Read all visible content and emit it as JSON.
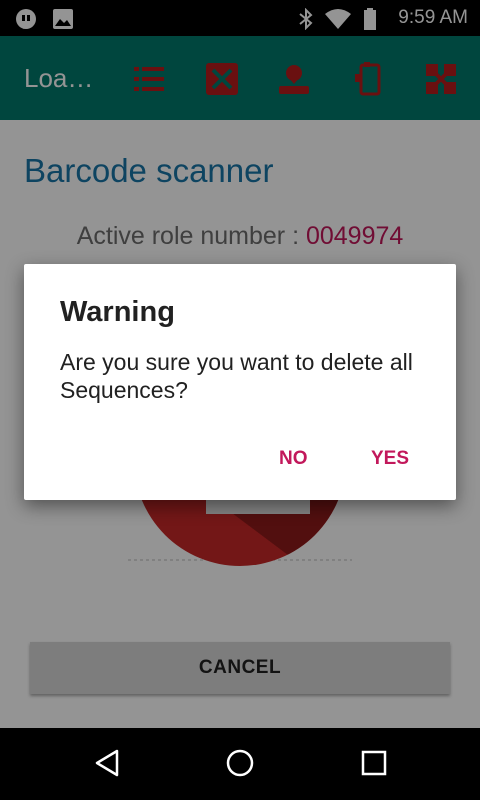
{
  "status_bar": {
    "time": "9:59 AM",
    "icons": [
      "chat-notification-icon",
      "image-icon",
      "bluetooth-icon",
      "wifi-icon",
      "battery-icon"
    ]
  },
  "app_bar": {
    "title": "Loa…",
    "actions": [
      "list-icon",
      "delete-box-icon",
      "user-location-icon",
      "device-icon",
      "grid-cancel-icon"
    ],
    "icon_color": "#b71c1c",
    "background": "#00796b"
  },
  "screen": {
    "title": "Barcode scanner",
    "role_label": "Active role number : ",
    "role_number": "0049974",
    "cancel_label": "CANCEL"
  },
  "dialog": {
    "title": "Warning",
    "message": "Are you sure you want to delete all Sequences?",
    "no_label": "NO",
    "yes_label": "YES",
    "accent": "#c2185b"
  },
  "nav_bar": {
    "icons": [
      "back-icon",
      "home-icon",
      "recents-icon"
    ]
  }
}
